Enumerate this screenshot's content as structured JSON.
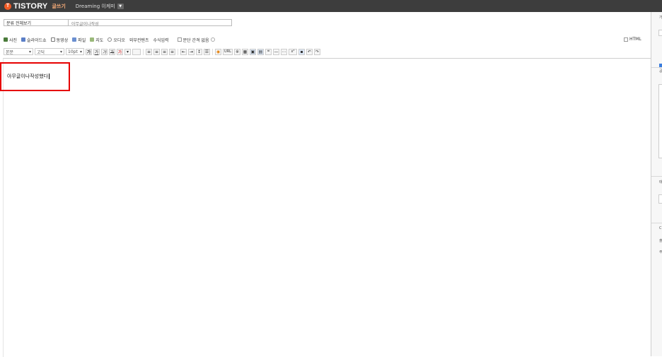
{
  "header": {
    "logo_letter": "T",
    "brand": "TISTORY",
    "write_label": "글쓰기",
    "blog_name": "Dreaming 이케미",
    "blog_dropdown_icon": "chevron-down-icon"
  },
  "post": {
    "category_value": "분류 전체보기",
    "title_value": "아무글이나작성",
    "body_text": "아무글이나작성했다"
  },
  "insert_toolbar": {
    "photo": "사진",
    "slideshow": "슬라이드쇼",
    "video": "동영상",
    "file": "파일",
    "map": "지도",
    "audio": "오디오",
    "external": "외부컨텐츠",
    "formula": "수식입력",
    "paragraph_spacing": "문단 간격 없음",
    "html_label": "HTML"
  },
  "format_toolbar": {
    "paragraph_style": "본문",
    "font": "고딕",
    "font_size": "10pt",
    "bold": "가",
    "underline": "가",
    "italic": "가",
    "strike": "가",
    "color": "가"
  },
  "right_panel": {
    "glyphs": [
      "가",
      "공",
      "태",
      "C",
      "출",
      "주"
    ]
  },
  "colors": {
    "topbar": "#3d3d3d",
    "logo": "#f15a24",
    "highlight": "#e60000"
  }
}
